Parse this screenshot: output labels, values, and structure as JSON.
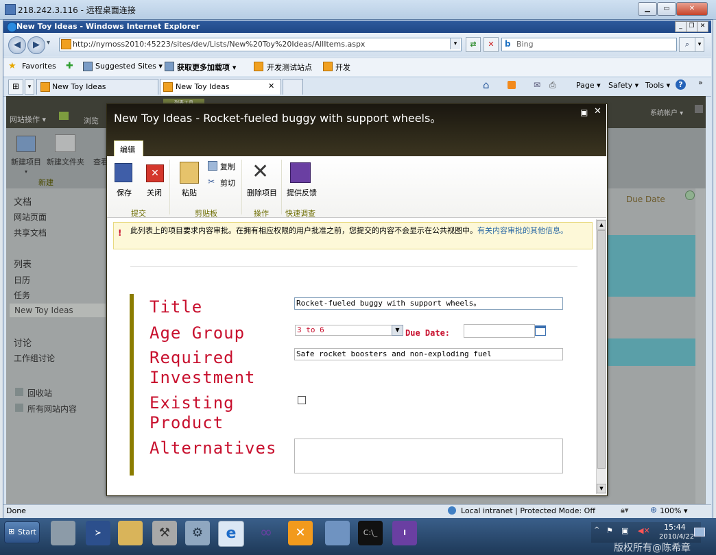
{
  "rdp": {
    "title": "218.242.3.116 - 远程桌面连接"
  },
  "ie": {
    "title": "New Toy Ideas - Windows Internet Explorer",
    "address": "http://nymoss2010:45223/sites/dev/Lists/New%20Toy%20Ideas/AllItems.aspx",
    "search_placeholder": "Bing",
    "favorites": {
      "favorites_label": "Favorites",
      "suggested_sites": "Suggested Sites ▾",
      "more_addons": "获取更多加载项 ▾",
      "dev_test": "开发测试站点",
      "dev": "开发"
    },
    "tabs": [
      {
        "label": "New Toy Ideas"
      },
      {
        "label": "New Toy Ideas"
      }
    ],
    "toolbar": {
      "page": "Page ▾",
      "safety": "Safety ▾",
      "tools": "Tools ▾",
      "help": "?"
    },
    "status": {
      "left": "Done",
      "zone": "Local intranet | Protected Mode: Off",
      "zoom": "100% ▾"
    }
  },
  "sharepoint": {
    "site_actions": "网站操作 ▾",
    "browse": "浏览",
    "tools_tab": "列表工具",
    "account": "系统帐户 ▾",
    "ribbon": {
      "new_item": "新建项目",
      "new_folder": "新建文件夹",
      "view": "查看",
      "group_new": "新建"
    },
    "nav": {
      "docs_header": "文档",
      "site_pages": "网站页面",
      "shared_docs": "共享文档",
      "lists_header": "列表",
      "calendar": "日历",
      "tasks": "任务",
      "new_toy_ideas": "New Toy Ideas",
      "discussions_header": "讨论",
      "team_discussion": "工作组讨论",
      "recycle_bin": "回收站",
      "all_content": "所有网站内容"
    },
    "due_date_header": "Due Date"
  },
  "dialog": {
    "title": "New Toy Ideas - Rocket-fueled buggy with support wheels。",
    "ribbon": {
      "tab_edit": "编辑",
      "save": "保存",
      "close": "关闭",
      "paste": "粘贴",
      "copy": "复制",
      "cut": "剪切",
      "delete_item": "删除项目",
      "feedback": "提供反馈",
      "group_commit": "提交",
      "group_clipboard": "剪贴板",
      "group_actions": "操作",
      "group_survey": "快速调查"
    },
    "warning": {
      "text": "此列表上的项目要求内容审批。在拥有相应权限的用户批准之前，您提交的内容不会显示在公共视图中。",
      "link": "有关内容审批的其他信息。"
    },
    "form": {
      "title_label": "Title",
      "title_value": "Rocket-fueled buggy with support wheels。",
      "age_label": "Age Group",
      "age_value": "3 to 6",
      "due_label": "Due Date:",
      "due_value": "",
      "investment_label_1": "Required",
      "investment_label_2": "Investment",
      "investment_value": "Safe rocket boosters and non-exploding fuel",
      "existing_label_1": "Existing",
      "existing_label_2": "Product",
      "alternatives_label": "Alternatives",
      "alternatives_value": ""
    }
  },
  "taskbar": {
    "start": "Start",
    "clock_time": "15:44",
    "clock_date": "2010/4/22",
    "watermark": "版权所有@陈希章"
  },
  "colors": {
    "label_red": "#c8102e",
    "accent_olive": "#8b7c00",
    "dialog_header": "#2a2618",
    "ie_blue": "#1f4787"
  }
}
